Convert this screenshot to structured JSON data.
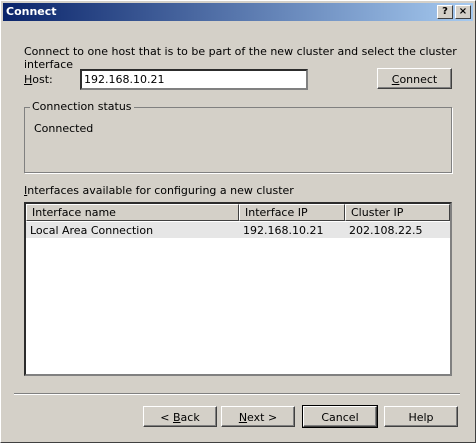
{
  "window": {
    "title": "Connect",
    "help_glyph": "?",
    "close_glyph": "×"
  },
  "intro_text": "Connect to one host that is to be part of the new cluster and select the cluster interface",
  "host": {
    "label_hot": "H",
    "label_rest": "ost:",
    "value": "192.168.10.21"
  },
  "connect_button": {
    "hot": "C",
    "rest": "onnect"
  },
  "connection_status": {
    "legend": "Connection status",
    "value": "Connected"
  },
  "interfaces": {
    "label_hot": "I",
    "label_rest": "nterfaces available for configuring a new cluster",
    "columns": [
      "Interface name",
      "Interface IP",
      "Cluster IP"
    ],
    "rows": [
      {
        "name": "Local Area Connection",
        "interface_ip": "192.168.10.21",
        "cluster_ip": "202.108.22.5"
      }
    ]
  },
  "footer": {
    "back": {
      "prefix": "< ",
      "hot": "B",
      "rest": "ack"
    },
    "next": {
      "hot": "N",
      "rest": "ext >"
    },
    "cancel": "Cancel",
    "help": "Help"
  }
}
